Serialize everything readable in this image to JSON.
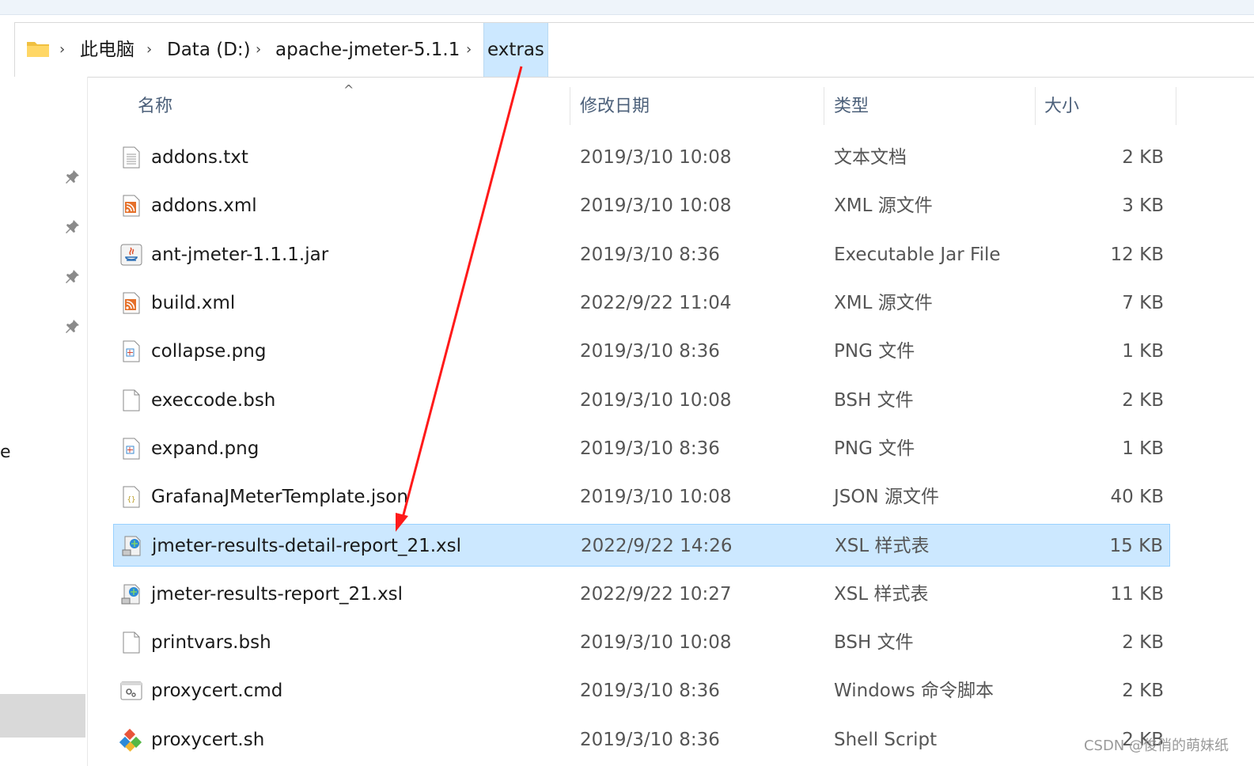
{
  "breadcrumb": {
    "items": [
      "此电脑",
      "Data (D:)",
      "apache-jmeter-5.1.1",
      "extras"
    ],
    "separator": "›"
  },
  "nav": {
    "partial_label": "e"
  },
  "columns": {
    "name": "名称",
    "date": "修改日期",
    "type": "类型",
    "size": "大小"
  },
  "sort_indicator": "^",
  "files": [
    {
      "name": "addons.txt",
      "date": "2019/3/10 10:08",
      "type": "文本文档",
      "size": "2 KB",
      "icon": "text-file-icon"
    },
    {
      "name": "addons.xml",
      "date": "2019/3/10 10:08",
      "type": "XML 源文件",
      "size": "3 KB",
      "icon": "xml-feed-icon"
    },
    {
      "name": "ant-jmeter-1.1.1.jar",
      "date": "2019/3/10 8:36",
      "type": "Executable Jar File",
      "size": "12 KB",
      "icon": "java-jar-icon"
    },
    {
      "name": "build.xml",
      "date": "2022/9/22 11:04",
      "type": "XML 源文件",
      "size": "7 KB",
      "icon": "xml-feed-icon"
    },
    {
      "name": "collapse.png",
      "date": "2019/3/10 8:36",
      "type": "PNG 文件",
      "size": "1 KB",
      "icon": "image-file-icon"
    },
    {
      "name": "execcode.bsh",
      "date": "2019/3/10 10:08",
      "type": "BSH 文件",
      "size": "2 KB",
      "icon": "blank-file-icon"
    },
    {
      "name": "expand.png",
      "date": "2019/3/10 8:36",
      "type": "PNG 文件",
      "size": "1 KB",
      "icon": "image-file-icon"
    },
    {
      "name": "GrafanaJMeterTemplate.json",
      "date": "2019/3/10 10:08",
      "type": "JSON 源文件",
      "size": "40 KB",
      "icon": "json-file-icon"
    },
    {
      "name": "jmeter-results-detail-report_21.xsl",
      "date": "2022/9/22 14:26",
      "type": "XSL 样式表",
      "size": "15 KB",
      "icon": "xsl-stylesheet-icon",
      "selected": true
    },
    {
      "name": "jmeter-results-report_21.xsl",
      "date": "2022/9/22 10:27",
      "type": "XSL 样式表",
      "size": "11 KB",
      "icon": "xsl-stylesheet-icon"
    },
    {
      "name": "printvars.bsh",
      "date": "2019/3/10 10:08",
      "type": "BSH 文件",
      "size": "2 KB",
      "icon": "blank-file-icon"
    },
    {
      "name": "proxycert.cmd",
      "date": "2019/3/10 8:36",
      "type": "Windows 命令脚本",
      "size": "2 KB",
      "icon": "cmd-script-icon"
    },
    {
      "name": "proxycert.sh",
      "date": "2019/3/10 8:36",
      "type": "Shell Script",
      "size": "2 KB",
      "icon": "git-shell-icon"
    }
  ],
  "watermark": "CSDN @俊俏的萌妹纸",
  "colors": {
    "selection": "#cce8ff",
    "selection_border": "#99d1ff",
    "annotation_arrow": "#ff1a1a",
    "header_text": "#4c607a"
  }
}
